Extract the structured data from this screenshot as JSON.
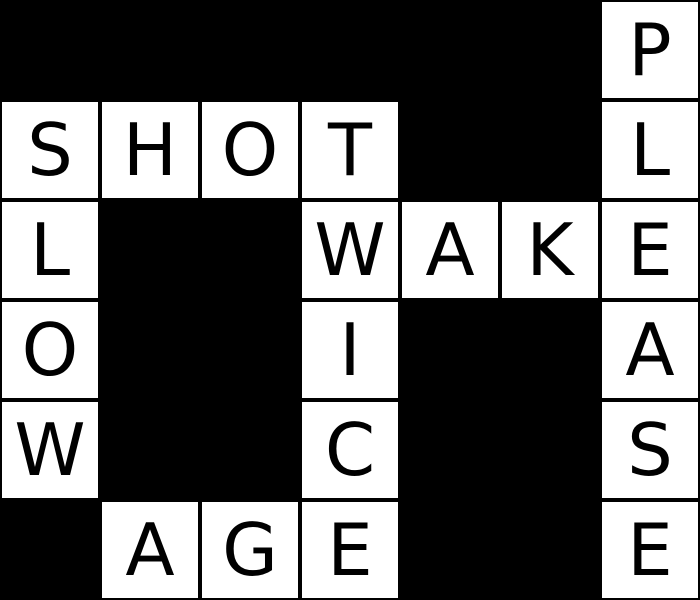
{
  "puzzle": {
    "rows": 6,
    "cols": 7,
    "colors": {
      "block": "#000000",
      "cell": "#ffffff",
      "letter": "#000000"
    },
    "grid": [
      [
        "#",
        "#",
        "#",
        "#",
        "#",
        "#",
        "P"
      ],
      [
        "S",
        "H",
        "O",
        "T",
        "#",
        "#",
        "L"
      ],
      [
        "L",
        "#",
        "#",
        "W",
        "A",
        "K",
        "E"
      ],
      [
        "O",
        "#",
        "#",
        "I",
        "#",
        "#",
        "A"
      ],
      [
        "W",
        "#",
        "#",
        "C",
        "#",
        "#",
        "S"
      ],
      [
        "#",
        "A",
        "G",
        "E",
        "#",
        "#",
        "E"
      ]
    ]
  }
}
